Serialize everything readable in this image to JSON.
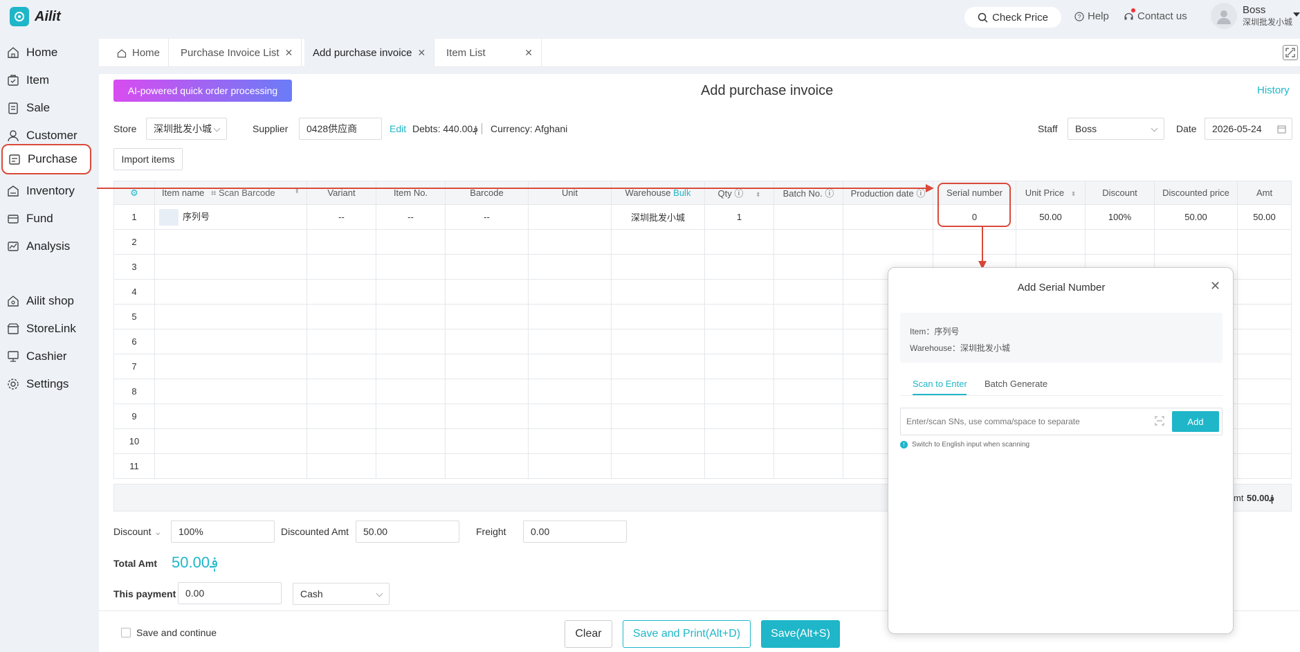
{
  "app": {
    "name": "Ailit"
  },
  "topbar": {
    "check_price": "Check Price",
    "help": "Help",
    "contact": "Contact us",
    "user_name": "Boss",
    "user_store": "深圳批发小城"
  },
  "sidebar": {
    "items": [
      {
        "label": "Home",
        "icon": "home-icon"
      },
      {
        "label": "Item",
        "icon": "item-icon"
      },
      {
        "label": "Sale",
        "icon": "sale-icon"
      },
      {
        "label": "Customer",
        "icon": "customer-icon"
      },
      {
        "label": "Purchase",
        "icon": "purchase-icon"
      },
      {
        "label": "Inventory",
        "icon": "inventory-icon"
      },
      {
        "label": "Fund",
        "icon": "fund-icon"
      },
      {
        "label": "Analysis",
        "icon": "analysis-icon"
      },
      {
        "label": "Ailit shop",
        "icon": "shop-icon"
      },
      {
        "label": "StoreLink",
        "icon": "storelink-icon"
      },
      {
        "label": "Cashier",
        "icon": "cashier-icon"
      },
      {
        "label": "Settings",
        "icon": "settings-icon"
      }
    ]
  },
  "tabs": [
    {
      "label": "Home"
    },
    {
      "label": "Purchase Invoice List"
    },
    {
      "label": "Add purchase invoice"
    },
    {
      "label": "Item List"
    }
  ],
  "page": {
    "ai_button": "AI-powered quick order processing",
    "title": "Add purchase invoice",
    "history": "History"
  },
  "form": {
    "store_label": "Store",
    "store_value": "深圳批发小城",
    "supplier_label": "Supplier",
    "supplier_value": "0428供应商",
    "edit": "Edit",
    "debts": "Debts: 440.00؋",
    "currency": "Currency: Afghani",
    "staff_label": "Staff",
    "staff_value": "Boss",
    "date_label": "Date",
    "date_value": "2026-05-24",
    "import_items": "Import items"
  },
  "table": {
    "headers": {
      "item_name": "Item name",
      "scan_barcode": "Scan Barcode",
      "variant": "Variant",
      "item_no": "Item No.",
      "barcode": "Barcode",
      "unit": "Unit",
      "warehouse": "Warehouse",
      "bulk": "Bulk",
      "qty": "Qty",
      "batch_no": "Batch No.",
      "production_date": "Production date",
      "serial_number": "Serial number",
      "unit_price": "Unit Price",
      "discount": "Discount",
      "discounted_price": "Discounted price",
      "amt": "Amt"
    },
    "row1": {
      "no": "1",
      "item_name": "序列号",
      "variant": "--",
      "item_no": "--",
      "barcode": "--",
      "unit": "",
      "warehouse": "深圳批发小城",
      "qty": "1",
      "serial_number": "0",
      "unit_price": "50.00",
      "discount": "100%",
      "discounted_price": "50.00",
      "amt": "50.00"
    },
    "row_numbers": [
      "2",
      "3",
      "4",
      "5",
      "6",
      "7",
      "8",
      "9",
      "10",
      "11"
    ],
    "summary_amt_label": "mt",
    "summary_amt": "50.00؋"
  },
  "totals": {
    "discount_label": "Discount",
    "discount_value": "100%",
    "discounted_amt_label": "Discounted Amt",
    "discounted_amt_value": "50.00",
    "freight_label": "Freight",
    "freight_value": "0.00",
    "total_amt_label": "Total Amt",
    "total_amt_value": "50.00؋",
    "payment_label": "This payment",
    "payment_value": "0.00",
    "payment_method": "Cash"
  },
  "footer": {
    "save_continue": "Save and continue",
    "clear": "Clear",
    "save_print": "Save and Print(Alt+D)",
    "save": "Save(Alt+S)"
  },
  "modal": {
    "title": "Add Serial Number",
    "item": "Item：序列号",
    "warehouse": "Warehouse：深圳批发小城",
    "tab_scan": "Scan to Enter",
    "tab_batch": "Batch Generate",
    "input_placeholder": "Enter/scan SNs, use comma/space to separate",
    "add": "Add",
    "tip": "Switch to English input when scanning"
  },
  "colors": {
    "accent": "#1fb6c9",
    "annotation": "#d94a3a"
  }
}
